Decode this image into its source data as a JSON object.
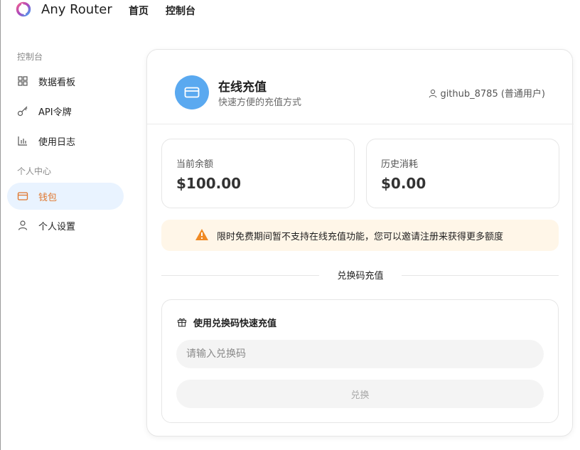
{
  "header": {
    "brand": "Any Router",
    "nav": [
      {
        "label": "首页"
      },
      {
        "label": "控制台"
      }
    ]
  },
  "sidebar": {
    "groups": [
      {
        "title": "控制台"
      },
      {
        "title": "个人中心"
      }
    ],
    "items": [
      {
        "label": "数据看板",
        "icon": "dashboard-icon"
      },
      {
        "label": "API令牌",
        "icon": "key-icon"
      },
      {
        "label": "使用日志",
        "icon": "chart-icon"
      },
      {
        "label": "钱包",
        "icon": "wallet-icon",
        "active": true
      },
      {
        "label": "个人设置",
        "icon": "user-icon"
      }
    ],
    "active_color": "#e0762c"
  },
  "topup": {
    "title": "在线充值",
    "subtitle": "快速方便的充值方式",
    "user": "github_8785 (普通用户)",
    "balance_label": "当前余额",
    "balance_value": "$100.00",
    "spent_label": "历史消耗",
    "spent_value": "$0.00",
    "notice": "限时免费期间暂不支持在线充值功能，您可以邀请注册来获得更多额度",
    "divider": "兑换码充值",
    "redeem_title": "使用兑换码快速充值",
    "redeem_placeholder": "请输入兑换码",
    "redeem_button": "兑换"
  }
}
